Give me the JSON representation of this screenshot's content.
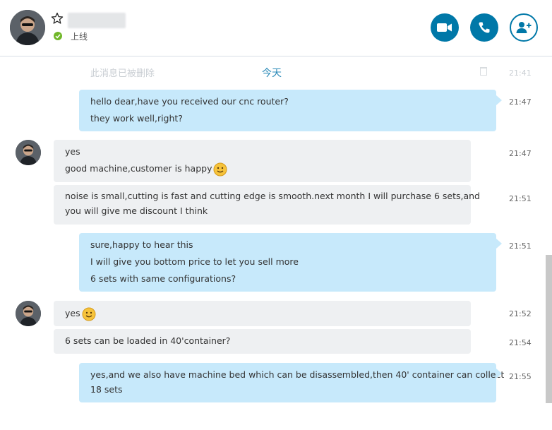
{
  "header": {
    "status_text": "上线",
    "colors": {
      "accent": "#0078a8",
      "online": "#71b72a"
    },
    "icons": [
      "star-icon",
      "video-icon",
      "phone-icon",
      "add-contact-icon",
      "checkmark-icon"
    ]
  },
  "chat": {
    "deleted_notice": "此消息已被删除",
    "deleted_time": "21:41",
    "date_separator": "今天",
    "messages": [
      {
        "direction": "out",
        "lines": [
          "hello dear,have you received our cnc router?",
          "they work well,right?"
        ],
        "time": "21:47"
      },
      {
        "direction": "in",
        "lines": [
          "yes",
          "good machine,customer is happy"
        ],
        "time": "21:47",
        "emoji": "smile"
      },
      {
        "direction": "in",
        "lines": [
          "noise is small,cutting is fast and cutting edge is smooth.next month I will purchase 6 sets,and",
          "you will give me discount I think"
        ],
        "time": "21:51"
      },
      {
        "direction": "out",
        "lines": [
          "sure,happy to hear this",
          "I will give you bottom price to let you sell more",
          "6 sets with same configurations?"
        ],
        "time": "21:51"
      },
      {
        "direction": "in",
        "lines": [
          "yes"
        ],
        "time": "21:52",
        "emoji": "smile"
      },
      {
        "direction": "in",
        "lines": [
          "6 sets can be loaded in 40'container?"
        ],
        "time": "21:54"
      },
      {
        "direction": "out",
        "lines": [
          "yes,and we also have machine bed which can be disassembled,then 40' container can collect",
          "18 sets"
        ],
        "time": "21:55"
      }
    ],
    "colors": {
      "outgoing_bubble": "#c7e9fb",
      "incoming_bubble": "#eef0f2",
      "date": "#2b8ab8"
    }
  }
}
